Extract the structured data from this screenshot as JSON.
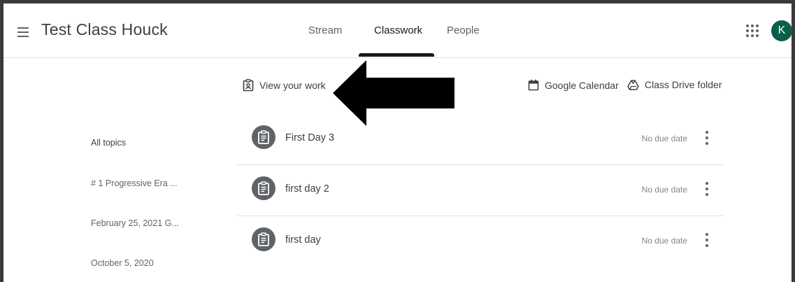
{
  "header": {
    "class_title": "Test Class Houck",
    "tabs": [
      {
        "label": "Stream"
      },
      {
        "label": "Classwork"
      },
      {
        "label": "People"
      }
    ],
    "active_tab": "Classwork",
    "avatar_initial": "K"
  },
  "actions": {
    "view_work": "View your work",
    "google_calendar": "Google Calendar",
    "drive_folder": "Class Drive folder"
  },
  "topics": [
    "All topics",
    "# 1 Progressive Era ...",
    "February 25, 2021 G...",
    "October 5, 2020"
  ],
  "assignments": [
    {
      "title": "First Day 3",
      "due": "No due date"
    },
    {
      "title": "first day 2",
      "due": "No due date"
    },
    {
      "title": "first day",
      "due": "No due date"
    }
  ],
  "colors": {
    "avatar_bg": "#0b5e4a",
    "icon_circle": "#5f6368",
    "active_tab_indicator": "#1a1a1a"
  }
}
